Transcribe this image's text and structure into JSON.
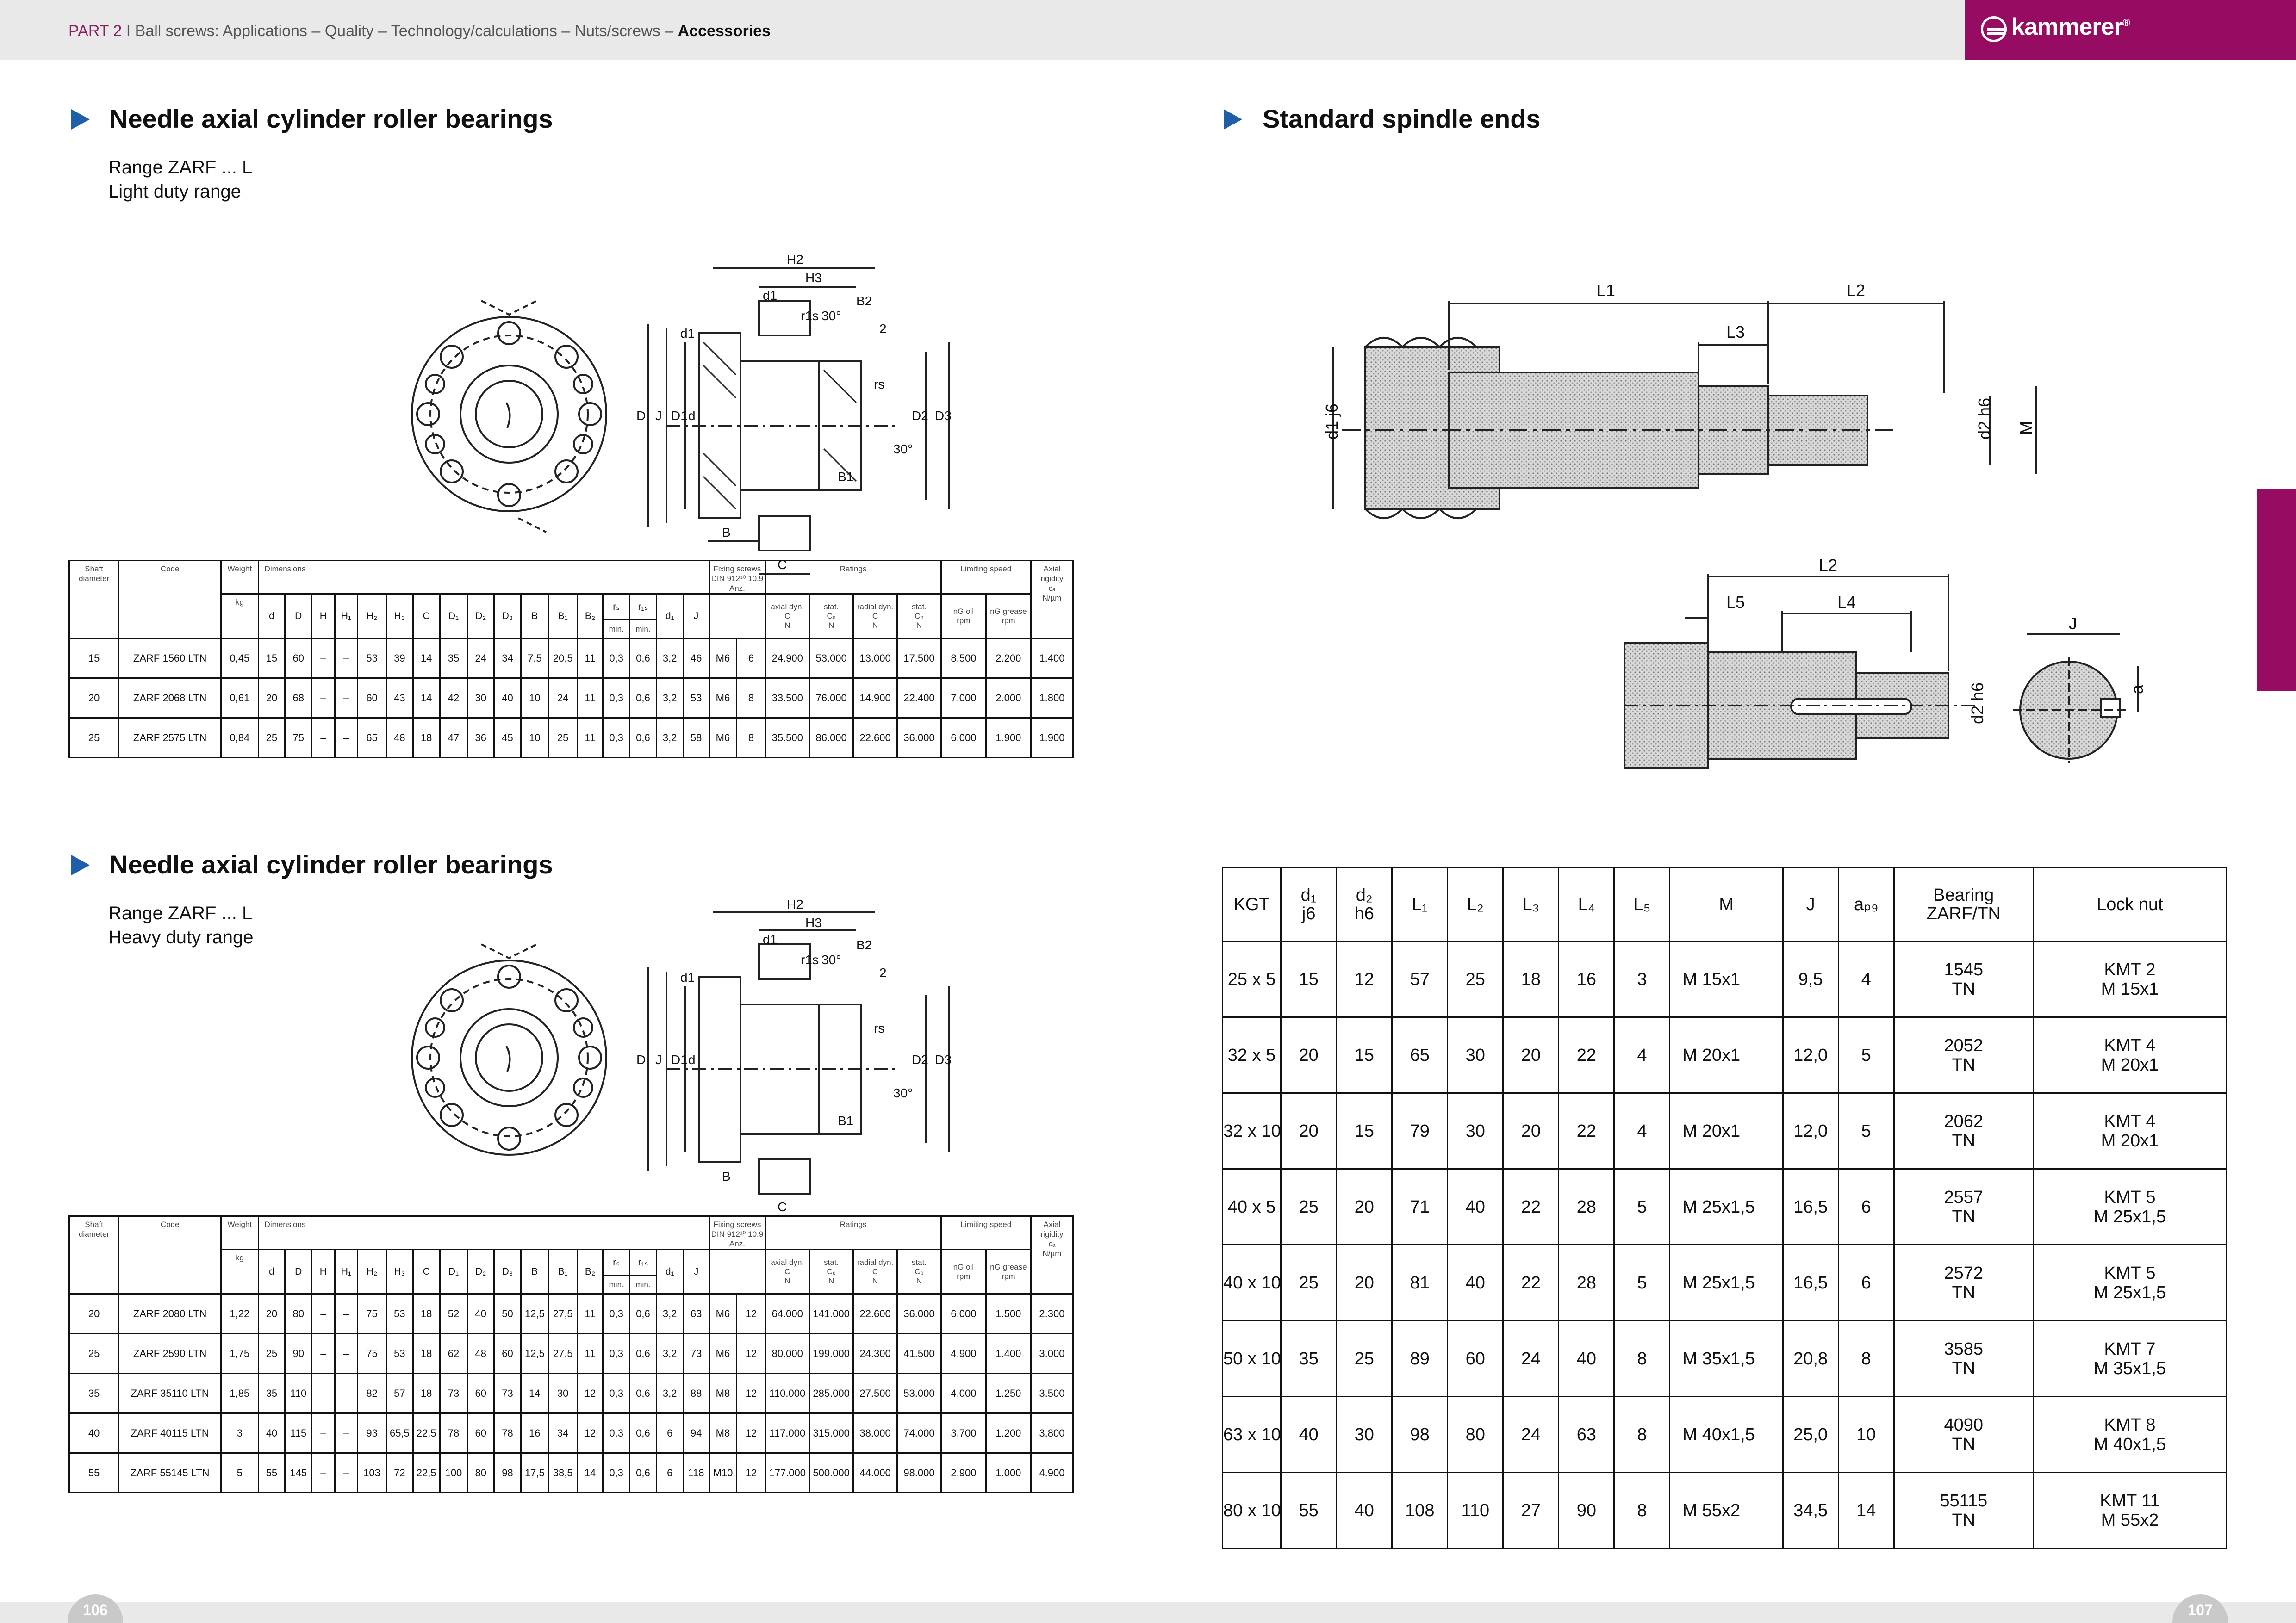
{
  "header": {
    "part": "PART 2",
    "sep": "I",
    "trail": "Ball screws: Applications – Quality – Technology/calculations – Nuts/screws –",
    "current": "Accessories",
    "brand": "kammerer",
    "brand_mark": "®"
  },
  "pages": {
    "left": "106",
    "right": "107"
  },
  "section1": {
    "title": "Needle axial cylinder roller bearings",
    "line1": "Range ZARF ... L",
    "line2": "Light duty range"
  },
  "section2": {
    "title": "Needle axial cylinder roller bearings",
    "line1": "Range ZARF ... L",
    "line2": "Heavy duty range"
  },
  "section3": {
    "title": "Standard spindle ends"
  },
  "drawing_labels": {
    "H2": "H2",
    "H3": "H3",
    "d1": "d1",
    "B2": "B2",
    "r1s": "r1s",
    "deg30": "30°",
    "two": "2",
    "rs": "rs",
    "D": "D",
    "J": "J",
    "D1": "D1",
    "d": "d",
    "D2": "D2",
    "D3": "D3",
    "B": "B",
    "B1": "B1",
    "C": "C"
  },
  "spindle_labels": {
    "L1": "L1",
    "L2": "L2",
    "L3": "L3",
    "L4": "L4",
    "L5": "L5",
    "d1j6": "d1 j6",
    "d2h6": "d2 h6",
    "M": "M",
    "J": "J",
    "a": "a"
  },
  "spec_headers": {
    "shaft": "Shaft diameter",
    "code": "Code",
    "weight": "Weight",
    "kg": "kg",
    "dimensions": "Dimensions",
    "fixing": "Fixing screws DIN 912¹⁰ 10.9 Anz.",
    "ratings": "Ratings",
    "limiting": "Limiting speed",
    "axial_rigidity": "Axial rigidity",
    "ca": "cₐ",
    "nmu": "N/µm",
    "dims": [
      "d",
      "D",
      "H",
      "H₁",
      "H₂",
      "H₃",
      "C",
      "D₁",
      "D₂",
      "D₃",
      "B",
      "B₁",
      "B₂",
      "rₛ",
      "r₁ₛ",
      "d₁",
      "J"
    ],
    "min": "min.",
    "axial_dyn": "axial dyn.",
    "stat": "stat.",
    "radial_dyn": "radial dyn.",
    "C": "C",
    "C0": "C₀",
    "N": "N",
    "oil": "nG oil",
    "grease": "nG grease",
    "rpm": "rpm"
  },
  "table_light": [
    [
      "15",
      "ZARF 1560 LTN",
      "0,45",
      "15",
      "60",
      "–",
      "–",
      "53",
      "39",
      "14",
      "35",
      "24",
      "34",
      "7,5",
      "20,5",
      "11",
      "0,3",
      "0,6",
      "3,2",
      "46",
      "M6",
      "6",
      "24.900",
      "53.000",
      "13.000",
      "17.500",
      "8.500",
      "2.200",
      "1.400"
    ],
    [
      "20",
      "ZARF 2068 LTN",
      "0,61",
      "20",
      "68",
      "–",
      "–",
      "60",
      "43",
      "14",
      "42",
      "30",
      "40",
      "10",
      "24",
      "11",
      "0,3",
      "0,6",
      "3,2",
      "53",
      "M6",
      "8",
      "33.500",
      "76.000",
      "14.900",
      "22.400",
      "7.000",
      "2.000",
      "1.800"
    ],
    [
      "25",
      "ZARF 2575 LTN",
      "0,84",
      "25",
      "75",
      "–",
      "–",
      "65",
      "48",
      "18",
      "47",
      "36",
      "45",
      "10",
      "25",
      "11",
      "0,3",
      "0,6",
      "3,2",
      "58",
      "M6",
      "8",
      "35.500",
      "86.000",
      "22.600",
      "36.000",
      "6.000",
      "1.900",
      "1.900"
    ]
  ],
  "table_heavy": [
    [
      "20",
      "ZARF 2080 LTN",
      "1,22",
      "20",
      "80",
      "–",
      "–",
      "75",
      "53",
      "18",
      "52",
      "40",
      "50",
      "12,5",
      "27,5",
      "11",
      "0,3",
      "0,6",
      "3,2",
      "63",
      "M6",
      "12",
      "64.000",
      "141.000",
      "22.600",
      "36.000",
      "6.000",
      "1.500",
      "2.300"
    ],
    [
      "25",
      "ZARF 2590 LTN",
      "1,75",
      "25",
      "90",
      "–",
      "–",
      "75",
      "53",
      "18",
      "62",
      "48",
      "60",
      "12,5",
      "27,5",
      "11",
      "0,3",
      "0,6",
      "3,2",
      "73",
      "M6",
      "12",
      "80.000",
      "199.000",
      "24.300",
      "41.500",
      "4.900",
      "1.400",
      "3.000"
    ],
    [
      "35",
      "ZARF 35110 LTN",
      "1,85",
      "35",
      "110",
      "–",
      "–",
      "82",
      "57",
      "18",
      "73",
      "60",
      "73",
      "14",
      "30",
      "12",
      "0,3",
      "0,6",
      "3,2",
      "88",
      "M8",
      "12",
      "110.000",
      "285.000",
      "27.500",
      "53.000",
      "4.000",
      "1.250",
      "3.500"
    ],
    [
      "40",
      "ZARF 40115 LTN",
      "3",
      "40",
      "115",
      "–",
      "–",
      "93",
      "65,5",
      "22,5",
      "78",
      "60",
      "78",
      "16",
      "34",
      "12",
      "0,3",
      "0,6",
      "6",
      "94",
      "M8",
      "12",
      "117.000",
      "315.000",
      "38.000",
      "74.000",
      "3.700",
      "1.200",
      "3.800"
    ],
    [
      "55",
      "ZARF 55145 LTN",
      "5",
      "55",
      "145",
      "–",
      "–",
      "103",
      "72",
      "22,5",
      "100",
      "80",
      "98",
      "17,5",
      "38,5",
      "14",
      "0,3",
      "0,6",
      "6",
      "118",
      "M10",
      "12",
      "177.000",
      "500.000",
      "44.000",
      "98.000",
      "2.900",
      "1.000",
      "4.900"
    ]
  ],
  "spindle_headers": [
    "KGT",
    "d₁\nj6",
    "d₂\nh6",
    "L₁",
    "L₂",
    "L₃",
    "L₄",
    "L₅",
    "M",
    "J",
    "a_P9",
    "Bearing\nZARF/TN",
    "Lock nut"
  ],
  "spindle_rows": [
    [
      "25 x  5",
      "15",
      "12",
      "57",
      "25",
      "18",
      "16",
      "3",
      "M 15x1",
      "9,5",
      "4",
      "1545\nTN",
      "KMT 2\nM 15x1"
    ],
    [
      "32 x  5",
      "20",
      "15",
      "65",
      "30",
      "20",
      "22",
      "4",
      "M 20x1",
      "12,0",
      "5",
      "2052\nTN",
      "KMT 4\nM 20x1"
    ],
    [
      "32 x 10",
      "20",
      "15",
      "79",
      "30",
      "20",
      "22",
      "4",
      "M 20x1",
      "12,0",
      "5",
      "2062\nTN",
      "KMT 4\nM 20x1"
    ],
    [
      "40 x  5",
      "25",
      "20",
      "71",
      "40",
      "22",
      "28",
      "5",
      "M 25x1,5",
      "16,5",
      "6",
      "2557\nTN",
      "KMT 5\nM 25x1,5"
    ],
    [
      "40 x 10",
      "25",
      "20",
      "81",
      "40",
      "22",
      "28",
      "5",
      "M 25x1,5",
      "16,5",
      "6",
      "2572\nTN",
      "KMT 5\nM 25x1,5"
    ],
    [
      "50 x 10",
      "35",
      "25",
      "89",
      "60",
      "24",
      "40",
      "8",
      "M 35x1,5",
      "20,8",
      "8",
      "3585\nTN",
      "KMT 7\nM 35x1,5"
    ],
    [
      "63 x 10",
      "40",
      "30",
      "98",
      "80",
      "24",
      "63",
      "8",
      "M 40x1,5",
      "25,0",
      "10",
      "4090\nTN",
      "KMT 8\nM 40x1,5"
    ],
    [
      "80 x 10",
      "55",
      "40",
      "108",
      "110",
      "27",
      "90",
      "8",
      "M 55x2",
      "34,5",
      "14",
      "55115\nTN",
      "KMT 11\nM 55x2"
    ]
  ],
  "colors": {
    "accent": "#960c63",
    "heading_arrow": "#1f5fa8",
    "bar": "#e9e9e9"
  }
}
